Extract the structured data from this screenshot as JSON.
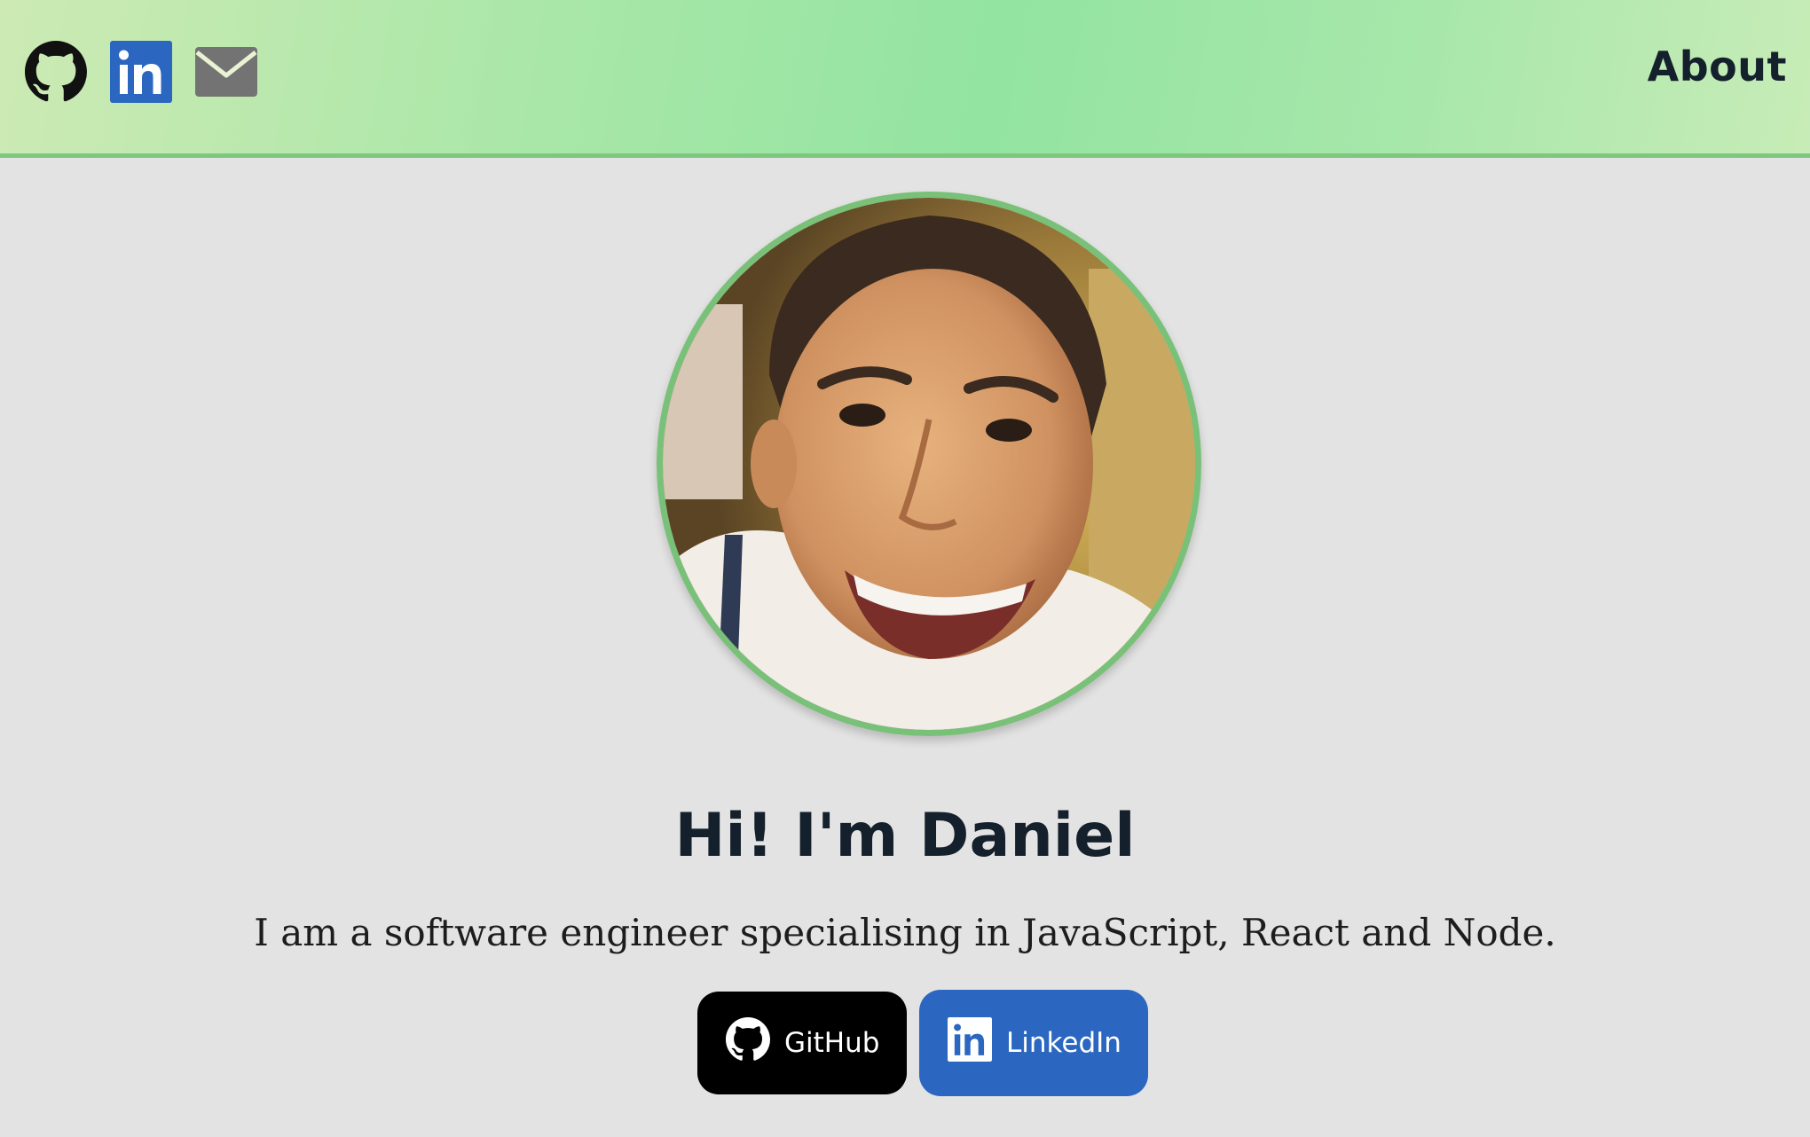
{
  "header": {
    "icons": [
      {
        "name": "github-icon"
      },
      {
        "name": "linkedin-icon"
      },
      {
        "name": "mail-icon"
      }
    ],
    "nav": {
      "about_label": "About"
    }
  },
  "profile": {
    "avatar": "photo-of-daniel",
    "heading": "Hi! I'm Daniel",
    "bio": "I am a software engineer specialising in JavaScript, React and Node."
  },
  "buttons": {
    "github_label": "GitHub",
    "linkedin_label": "LinkedIn"
  },
  "colors": {
    "header_green": "#93e4a1",
    "border_green": "#79c178",
    "linkedin_blue": "#2b67c0",
    "github_black": "#000000",
    "page_bg": "#e3e3e3",
    "heading_text": "#14202b"
  }
}
